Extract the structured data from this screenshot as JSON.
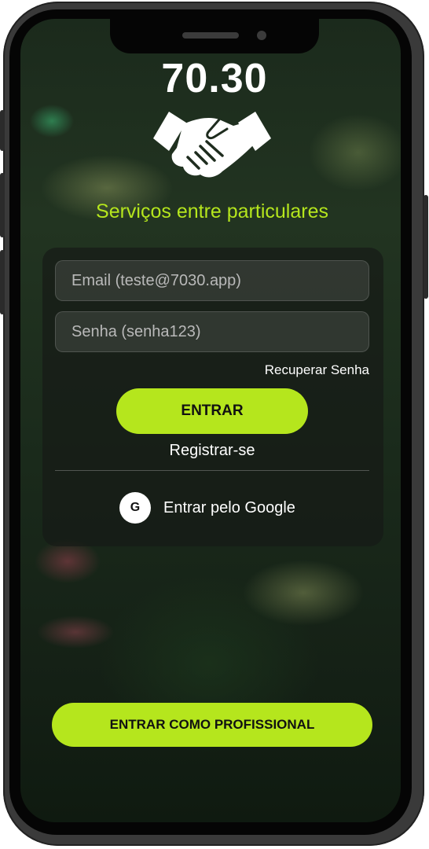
{
  "app": {
    "title": "70.30",
    "subtitle": "Serviços entre particulares",
    "logo_icon": "handshake-icon"
  },
  "login": {
    "email_placeholder": "Email (teste@7030.app)",
    "password_placeholder": "Senha (senha123)",
    "recover_label": "Recuperar Senha",
    "submit_label": "ENTRAR",
    "register_label": "Registrar-se",
    "google_icon_letter": "G",
    "google_label": "Entrar pelo Google"
  },
  "professional": {
    "button_label": "ENTRAR COMO PROFISSIONAL"
  },
  "colors": {
    "accent": "#b5e61d",
    "text": "#ffffff"
  }
}
